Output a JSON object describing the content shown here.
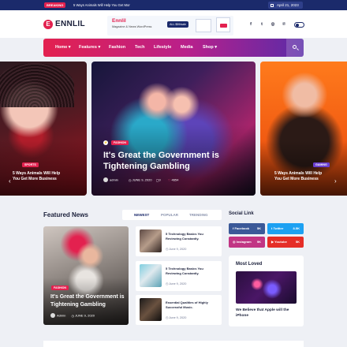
{
  "topbar": {
    "breaking_label": "BREAKING",
    "breaking_text": "5 Ways Animals Will Help You Get Mor",
    "date": "April 21, 2023"
  },
  "header": {
    "logo_letter": "E",
    "logo_text": "ENNLIL",
    "ad": {
      "title": "Ennlil",
      "subtitle": "Magazine & News WordPress",
      "button": "ALL $59/sale"
    },
    "social_icons": [
      "f",
      "t",
      "◎",
      "℗"
    ]
  },
  "nav": {
    "items": [
      "Home",
      "Features",
      "Fashion",
      "Tech",
      "Lifestyle",
      "Media",
      "Shop"
    ]
  },
  "slider": {
    "left": {
      "tag": "SPORTS",
      "title_line1": "5 Ways Animals Will Help",
      "title_line2": "You Get More Business"
    },
    "center": {
      "tag": "FASHION",
      "title": "It's Great the Government is Tightening Gambling",
      "author": "admin",
      "date": "JUNE 9, 2020",
      "comments": "0",
      "views": "4654"
    },
    "right": {
      "tag": "GAMING",
      "title_line1": "5 Ways Animals Will Help",
      "title_line2": "You Get More Business"
    }
  },
  "featured": {
    "title": "Featured News",
    "tabs": [
      "NEWEST",
      "POPULAR",
      "TRENDING"
    ],
    "main": {
      "tag": "FASHION",
      "title": "It's Great the Government is Tightening Gambling",
      "author": "Admin",
      "date": "JUNE 9, 2020"
    },
    "items": [
      {
        "title": "5 Technology Basics You Reviewing Constantly.",
        "date": "June 9, 2020"
      },
      {
        "title": "5 Technology Basics You Reviewing Constantly.",
        "date": "June 9, 2020"
      },
      {
        "title": "Essential Qualities of Highly Successful Music.",
        "date": "June 9, 2020"
      }
    ]
  },
  "sidebar": {
    "social_title": "Social Link",
    "social": [
      {
        "name": "Facebook",
        "count": "5K",
        "color": "#3b5998"
      },
      {
        "name": "Twitter",
        "count": "8.5K",
        "color": "#1da1f2"
      },
      {
        "name": "Instagram",
        "count": "9K",
        "color": "#c13584"
      },
      {
        "name": "Youtube",
        "count": "5K",
        "color": "#e52d27"
      }
    ],
    "most_loved_title": "Most Loved",
    "most_loved_item": "We Believe that Apple will the iPhone"
  },
  "colors": {
    "accent": "#e3214f",
    "navy": "#1b2a6b",
    "purple": "#5a2ba8"
  }
}
